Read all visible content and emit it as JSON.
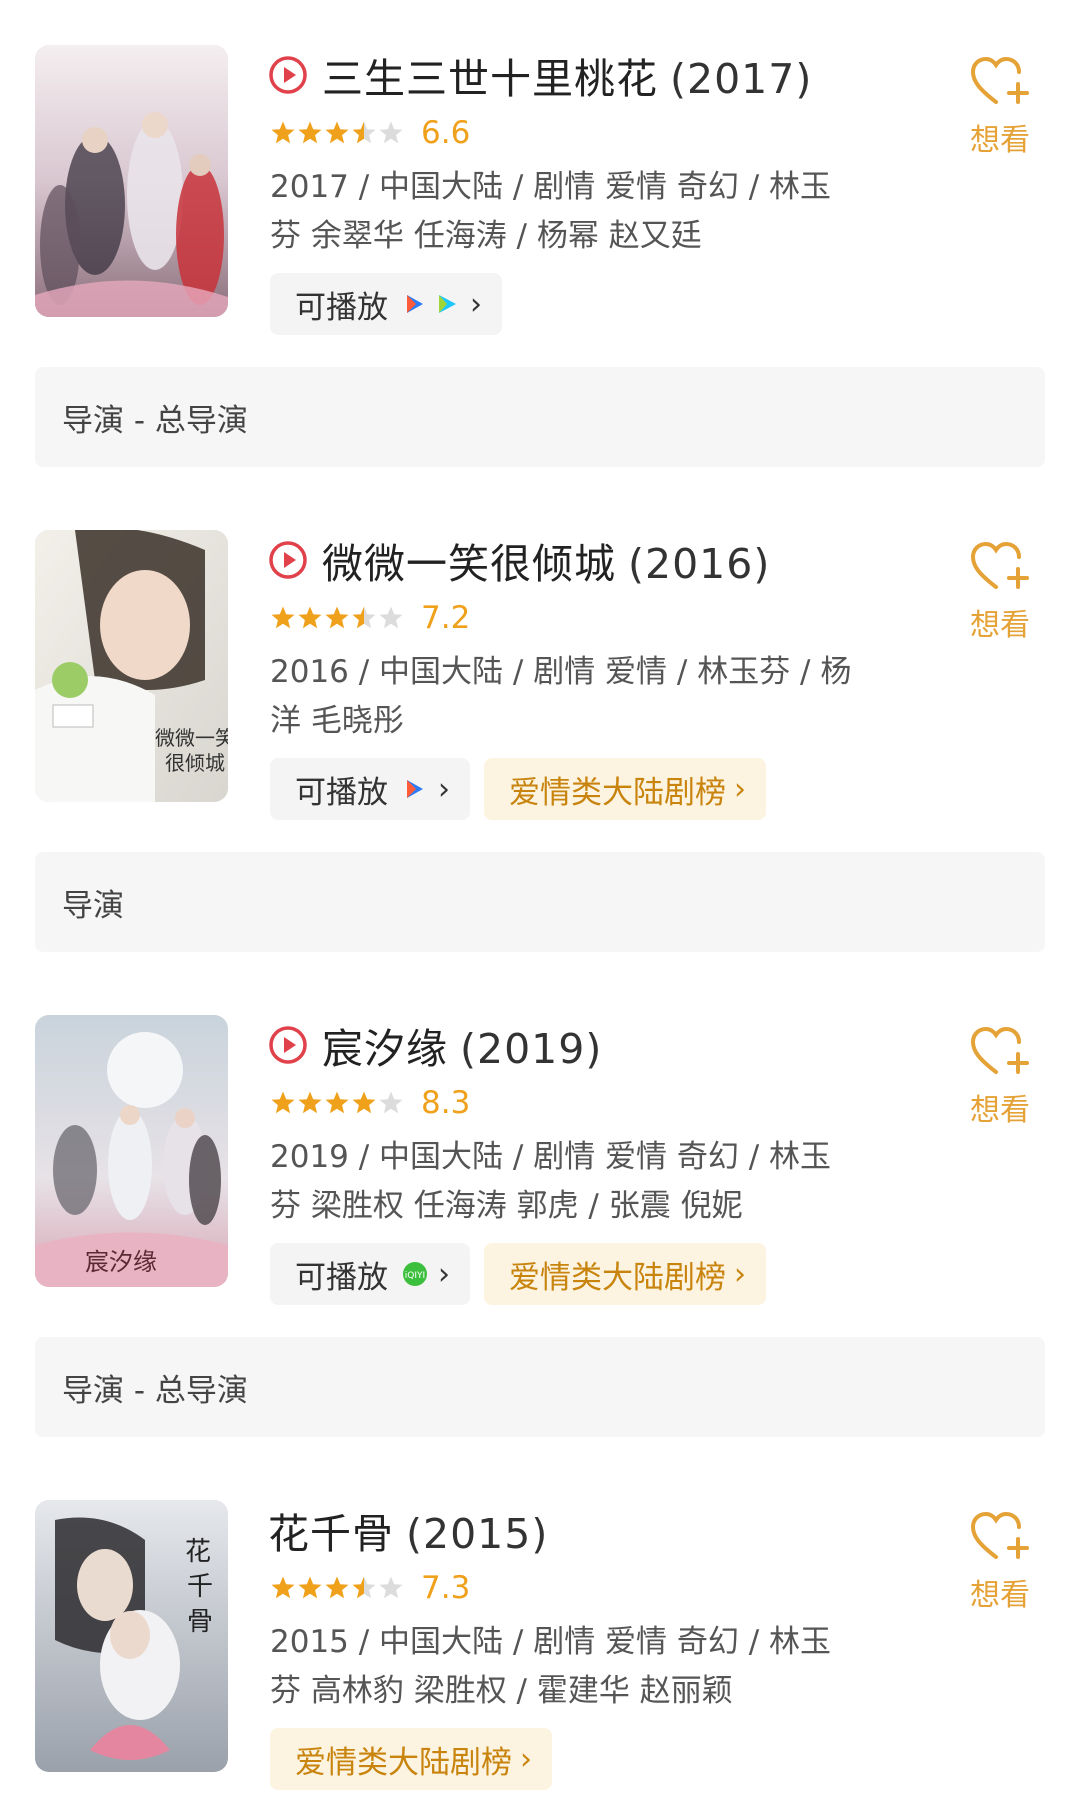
{
  "items": [
    {
      "has_play_icon": true,
      "title": "三生三世十里桃花",
      "year": "(2017)",
      "stars": 3.5,
      "score": "6.6",
      "meta_line1": "2017 / 中国大陆 / 剧情 爱情 奇幻 / 林玉",
      "meta_line2": "芬 余翠华 任海涛 / 杨幂 赵又廷",
      "play_label": "可播放",
      "sources": [
        "tencent-video-icon",
        "youku-icon"
      ],
      "rank_label": "",
      "want_label": "想看",
      "director": "导演 - 总导演"
    },
    {
      "has_play_icon": true,
      "title": "微微一笑很倾城",
      "year": "(2016)",
      "stars": 3.5,
      "score": "7.2",
      "meta_line1": "2016 / 中国大陆 / 剧情 爱情 / 林玉芬 / 杨",
      "meta_line2": "洋 毛晓彤",
      "play_label": "可播放",
      "sources": [
        "tencent-video-icon"
      ],
      "rank_label": "爱情类大陆剧榜",
      "want_label": "想看",
      "director": "导演"
    },
    {
      "has_play_icon": true,
      "title": "宸汐缘",
      "year": "(2019)",
      "stars": 4,
      "score": "8.3",
      "meta_line1": "2019 / 中国大陆 / 剧情 爱情 奇幻 / 林玉",
      "meta_line2": "芬 梁胜权 任海涛 郭虎 / 张震 倪妮",
      "play_label": "可播放",
      "sources": [
        "iqiyi-icon"
      ],
      "rank_label": "爱情类大陆剧榜",
      "want_label": "想看",
      "director": "导演 - 总导演"
    },
    {
      "has_play_icon": false,
      "title": "花千骨",
      "year": "(2015)",
      "stars": 3.5,
      "score": "7.3",
      "meta_line1": "2015 / 中国大陆 / 剧情 爱情 奇幻 / 林玉",
      "meta_line2": "芬 高林豹 梁胜权 / 霍建华 赵丽颖",
      "play_label": "",
      "sources": [],
      "rank_label": "爱情类大陆剧榜",
      "want_label": "想看",
      "director": ""
    }
  ],
  "colors": {
    "accent": "#e5a237",
    "star": "#f0a11c",
    "play_icon": "#e0414a",
    "rank_bg": "#fcf3e1",
    "rank_text": "#c8840d"
  }
}
